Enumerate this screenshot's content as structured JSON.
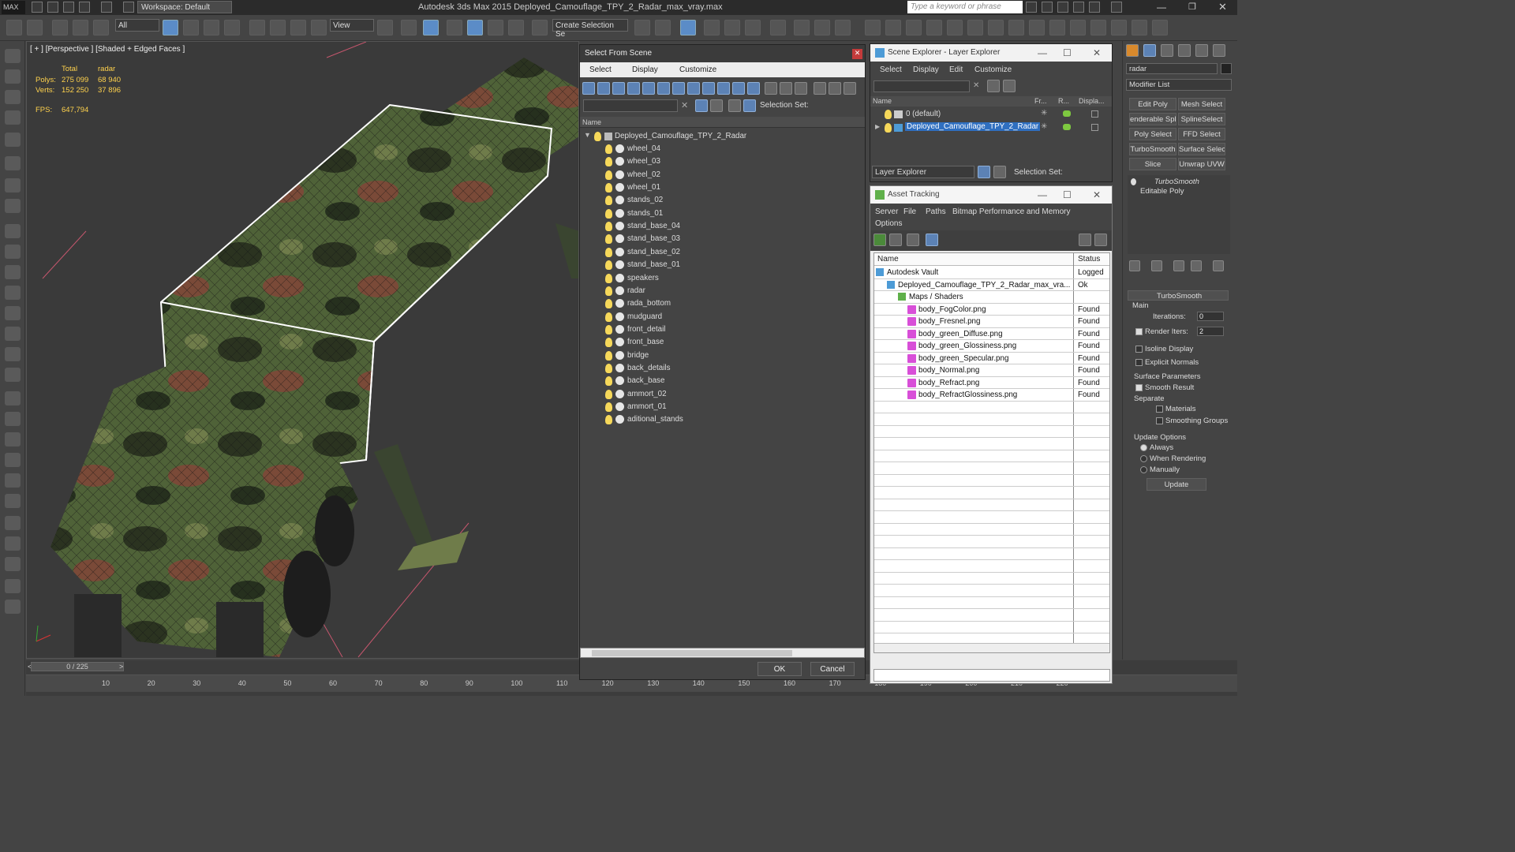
{
  "app": {
    "title": "Autodesk 3ds Max  2015     Deployed_Camouflage_TPY_2_Radar_max_vray.max",
    "workspace": "Workspace: Default",
    "search_placeholder": "Type a keyword or phrase"
  },
  "toolbar": {
    "selection_filter": "All",
    "ref_coord": "View",
    "named_selection": "Create Selection Se"
  },
  "viewport": {
    "label": "[ + ] [Perspective ] [Shaded + Edged Faces ]",
    "stats": {
      "header_total": "Total",
      "header_obj": "radar",
      "polys_label": "Polys:",
      "polys_total": "275 099",
      "polys_obj": "68 940",
      "verts_label": "Verts:",
      "verts_total": "152 250",
      "verts_obj": "37 896",
      "fps_label": "FPS:",
      "fps_value": "647,794"
    }
  },
  "timeline": {
    "frame": "0 / 225",
    "ticks": [
      "10",
      "20",
      "30",
      "40",
      "50",
      "60",
      "70",
      "80",
      "90",
      "100",
      "110",
      "120",
      "130",
      "140",
      "150",
      "160",
      "170",
      "180",
      "190",
      "200",
      "210",
      "220"
    ]
  },
  "select_from_scene": {
    "title": "Select From Scene",
    "menu": [
      "Select",
      "Display",
      "Customize"
    ],
    "selection_set_label": "Selection Set:",
    "column_name": "Name",
    "root": "Deployed_Camouflage_TPY_2_Radar",
    "objects": [
      "wheel_04",
      "wheel_03",
      "wheel_02",
      "wheel_01",
      "stands_02",
      "stands_01",
      "stand_base_04",
      "stand_base_03",
      "stand_base_02",
      "stand_base_01",
      "speakers",
      "radar",
      "rada_bottom",
      "mudguard",
      "front_detail",
      "front_base",
      "bridge",
      "back_details",
      "back_base",
      "ammort_02",
      "ammort_01",
      "aditional_stands"
    ],
    "ok": "OK",
    "cancel": "Cancel"
  },
  "scene_explorer": {
    "title": "Scene Explorer - Layer Explorer",
    "menu": [
      "Select",
      "Display",
      "Edit",
      "Customize"
    ],
    "columns": [
      "Name",
      "Fr...",
      "R...",
      "Displa..."
    ],
    "layers": [
      "0 (default)",
      "Deployed_Camouflage_TPY_2_Radar"
    ],
    "footer_dropdown": "Layer Explorer",
    "selection_set_label": "Selection Set:"
  },
  "asset_tracking": {
    "title": "Asset Tracking",
    "menu": [
      "Server",
      "File",
      "Paths",
      "Bitmap Performance and Memory",
      "Options"
    ],
    "columns": [
      "Name",
      "Status"
    ],
    "rows": [
      {
        "name": "Autodesk Vault",
        "status": "Logged"
      },
      {
        "name": "Deployed_Camouflage_TPY_2_Radar_max_vra...",
        "status": "Ok"
      },
      {
        "name": "Maps / Shaders",
        "status": ""
      },
      {
        "name": "body_FogColor.png",
        "status": "Found"
      },
      {
        "name": "body_Fresnel.png",
        "status": "Found"
      },
      {
        "name": "body_green_Diffuse.png",
        "status": "Found"
      },
      {
        "name": "body_green_Glossiness.png",
        "status": "Found"
      },
      {
        "name": "body_green_Specular.png",
        "status": "Found"
      },
      {
        "name": "body_Normal.png",
        "status": "Found"
      },
      {
        "name": "body_Refract.png",
        "status": "Found"
      },
      {
        "name": "body_RefractGlossiness.png",
        "status": "Found"
      }
    ]
  },
  "command_panel": {
    "object_name": "radar",
    "modifier_list": "Modifier List",
    "buttons": [
      "Edit Poly",
      "Mesh Select",
      "enderable Splir",
      "SplineSelect",
      "Poly Select",
      "FFD Select",
      "TurboSmooth",
      "Surface Select",
      "Slice",
      "Unwrap UVW"
    ],
    "stack": [
      "TurboSmooth",
      "Editable Poly"
    ],
    "rollout_title": "TurboSmooth",
    "main_label": "Main",
    "iterations_label": "Iterations:",
    "iterations_value": "0",
    "render_iters_label": "Render Iters:",
    "render_iters_value": "2",
    "isoline_display": "Isoline Display",
    "explicit_normals": "Explicit Normals",
    "surface_params": "Surface Parameters",
    "smooth_result": "Smooth Result",
    "separate": "Separate",
    "materials": "Materials",
    "smoothing_groups": "Smoothing Groups",
    "update_options": "Update Options",
    "always": "Always",
    "when_rendering": "When Rendering",
    "manually": "Manually",
    "update_button": "Update"
  }
}
